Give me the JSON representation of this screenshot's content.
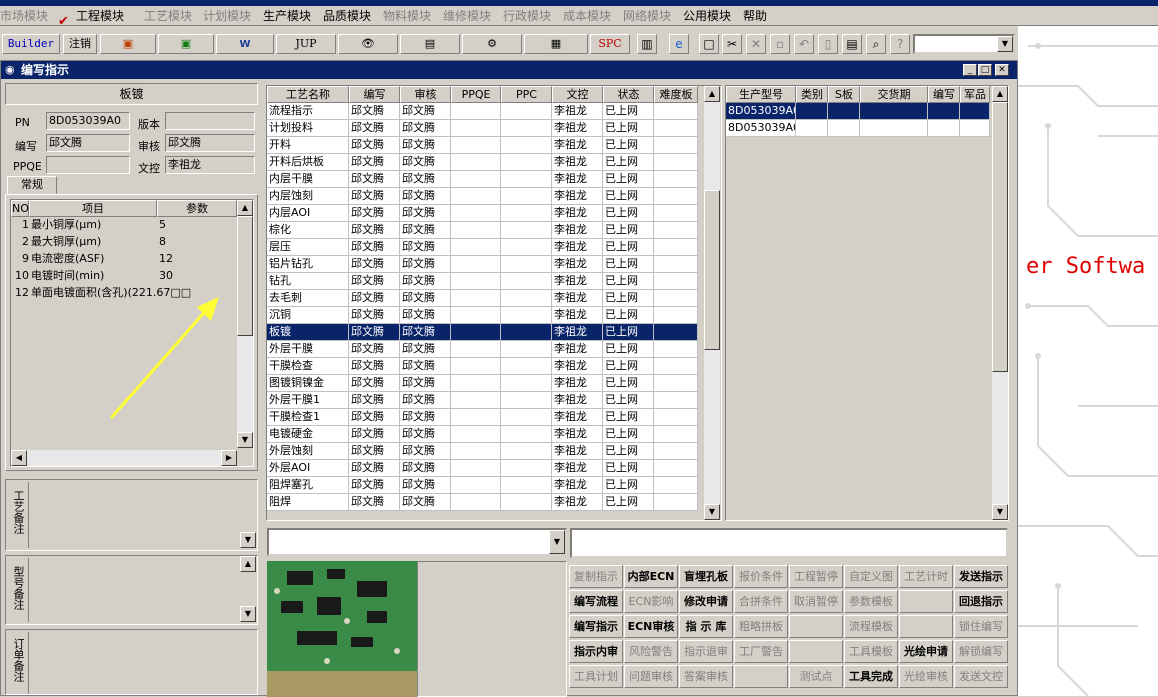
{
  "menu": [
    "市场模块",
    "工程模块",
    "工艺模块",
    "计划模块",
    "生产模块",
    "品质模块",
    "物料模块",
    "维修模块",
    "行政模块",
    "成本模块",
    "网络模块",
    "公用模块",
    "帮助"
  ],
  "menu_enabled": [
    false,
    true,
    false,
    false,
    true,
    true,
    false,
    false,
    false,
    false,
    false,
    true,
    true
  ],
  "toolbar": {
    "builder": "Builder",
    "logout": "注销",
    "jup": "JUP",
    "spc": "SPC"
  },
  "window": {
    "title": "编写指示"
  },
  "left": {
    "section_title": "板镀",
    "pn_label": "PN",
    "pn": "8D053039A0",
    "version_label": "版本",
    "version": "",
    "writer_label": "编写",
    "writer": "邱文腾",
    "reviewer_label": "审核",
    "reviewer": "邱文腾",
    "ppqe_label": "PPQE",
    "ppqe": "",
    "doc_label": "文控",
    "doc": "李祖龙",
    "tab": "常规",
    "param_headers": [
      "NO",
      "项目",
      "参数"
    ],
    "params": [
      {
        "no": "1",
        "item": "最小铜厚(μm)",
        "val": "5"
      },
      {
        "no": "2",
        "item": "最大铜厚(μm)",
        "val": "8"
      },
      {
        "no": "9",
        "item": "电流密度(ASF)",
        "val": "12"
      },
      {
        "no": "10",
        "item": "电镀时间(min)",
        "val": "30"
      },
      {
        "no": "12",
        "item": "单面电镀面积(含孔)(221.67□□",
        "val": ""
      }
    ],
    "memo_labels": [
      "工艺备注",
      "型号备注",
      "订单备注"
    ]
  },
  "process": {
    "headers": [
      "工艺名称",
      "编写",
      "审核",
      "PPQE",
      "PPC",
      "文控",
      "状态",
      "难度板"
    ],
    "rows": [
      [
        "流程指示",
        "邱文腾",
        "邱文腾",
        "",
        "",
        "李祖龙",
        "已上网",
        ""
      ],
      [
        "计划投料",
        "邱文腾",
        "邱文腾",
        "",
        "",
        "李祖龙",
        "已上网",
        ""
      ],
      [
        "开料",
        "邱文腾",
        "邱文腾",
        "",
        "",
        "李祖龙",
        "已上网",
        ""
      ],
      [
        "开料后烘板",
        "邱文腾",
        "邱文腾",
        "",
        "",
        "李祖龙",
        "已上网",
        ""
      ],
      [
        "内层干膜",
        "邱文腾",
        "邱文腾",
        "",
        "",
        "李祖龙",
        "已上网",
        ""
      ],
      [
        "内层蚀刻",
        "邱文腾",
        "邱文腾",
        "",
        "",
        "李祖龙",
        "已上网",
        ""
      ],
      [
        "内层AOI",
        "邱文腾",
        "邱文腾",
        "",
        "",
        "李祖龙",
        "已上网",
        ""
      ],
      [
        "棕化",
        "邱文腾",
        "邱文腾",
        "",
        "",
        "李祖龙",
        "已上网",
        ""
      ],
      [
        "层压",
        "邱文腾",
        "邱文腾",
        "",
        "",
        "李祖龙",
        "已上网",
        ""
      ],
      [
        "铝片钻孔",
        "邱文腾",
        "邱文腾",
        "",
        "",
        "李祖龙",
        "已上网",
        ""
      ],
      [
        "钻孔",
        "邱文腾",
        "邱文腾",
        "",
        "",
        "李祖龙",
        "已上网",
        ""
      ],
      [
        "去毛刺",
        "邱文腾",
        "邱文腾",
        "",
        "",
        "李祖龙",
        "已上网",
        ""
      ],
      [
        "沉铜",
        "邱文腾",
        "邱文腾",
        "",
        "",
        "李祖龙",
        "已上网",
        ""
      ],
      [
        "板镀",
        "邱文腾",
        "邱文腾",
        "",
        "",
        "李祖龙",
        "已上网",
        ""
      ],
      [
        "外层干膜",
        "邱文腾",
        "邱文腾",
        "",
        "",
        "李祖龙",
        "已上网",
        ""
      ],
      [
        "干膜检查",
        "邱文腾",
        "邱文腾",
        "",
        "",
        "李祖龙",
        "已上网",
        ""
      ],
      [
        "图镀铜镍金",
        "邱文腾",
        "邱文腾",
        "",
        "",
        "李祖龙",
        "已上网",
        ""
      ],
      [
        "外层干膜1",
        "邱文腾",
        "邱文腾",
        "",
        "",
        "李祖龙",
        "已上网",
        ""
      ],
      [
        "干膜检查1",
        "邱文腾",
        "邱文腾",
        "",
        "",
        "李祖龙",
        "已上网",
        ""
      ],
      [
        "电镀硬金",
        "邱文腾",
        "邱文腾",
        "",
        "",
        "李祖龙",
        "已上网",
        ""
      ],
      [
        "外层蚀刻",
        "邱文腾",
        "邱文腾",
        "",
        "",
        "李祖龙",
        "已上网",
        ""
      ],
      [
        "外层AOI",
        "邱文腾",
        "邱文腾",
        "",
        "",
        "李祖龙",
        "已上网",
        ""
      ],
      [
        "阻焊塞孔",
        "邱文腾",
        "邱文腾",
        "",
        "",
        "李祖龙",
        "已上网",
        ""
      ],
      [
        "阻焊",
        "邱文腾",
        "邱文腾",
        "",
        "",
        "李祖龙",
        "已上网",
        ""
      ]
    ],
    "selected": 13
  },
  "models": {
    "headers": [
      "生产型号",
      "类别",
      "S板",
      "交货期",
      "编写",
      "军品"
    ],
    "rows": [
      [
        "8D053039A0",
        "",
        "",
        "",
        "",
        ""
      ],
      [
        "8D053039A0",
        "",
        "",
        "",
        "",
        ""
      ]
    ],
    "selected": 0
  },
  "background_text": "er Softwa",
  "actions": [
    [
      {
        "t": "复制指示",
        "e": false
      },
      {
        "t": "内部ECN",
        "e": true
      },
      {
        "t": "盲埋孔板",
        "e": true
      },
      {
        "t": "报价条件",
        "e": false
      },
      {
        "t": "工程暂停",
        "e": false
      },
      {
        "t": "自定义图",
        "e": false
      },
      {
        "t": "工艺计时",
        "e": false
      },
      {
        "t": "发送指示",
        "e": true
      }
    ],
    [
      {
        "t": "编写流程",
        "e": true
      },
      {
        "t": "ECN影响",
        "e": false
      },
      {
        "t": "修改申请",
        "e": true
      },
      {
        "t": "合拼条件",
        "e": false
      },
      {
        "t": "取消暂停",
        "e": false
      },
      {
        "t": "参数模板",
        "e": false
      },
      {
        "t": "",
        "e": false
      },
      {
        "t": "回退指示",
        "e": true
      }
    ],
    [
      {
        "t": "编写指示",
        "e": true
      },
      {
        "t": "ECN审核",
        "e": true
      },
      {
        "t": "指 示 库",
        "e": true
      },
      {
        "t": "粗略拼板",
        "e": false
      },
      {
        "t": "",
        "e": false
      },
      {
        "t": "流程模板",
        "e": false
      },
      {
        "t": "",
        "e": false
      },
      {
        "t": "锁住编写",
        "e": false
      }
    ],
    [
      {
        "t": "指示内审",
        "e": true
      },
      {
        "t": "风险警告",
        "e": false
      },
      {
        "t": "指示退审",
        "e": false
      },
      {
        "t": "工厂警告",
        "e": false
      },
      {
        "t": "",
        "e": false
      },
      {
        "t": "工具模板",
        "e": false
      },
      {
        "t": "光绘申请",
        "e": true
      },
      {
        "t": "解锁编写",
        "e": false
      }
    ],
    [
      {
        "t": "工具计划",
        "e": false
      },
      {
        "t": "问题审核",
        "e": false
      },
      {
        "t": "答案审核",
        "e": false
      },
      {
        "t": "",
        "e": false
      },
      {
        "t": "测试点",
        "e": false
      },
      {
        "t": "工具完成",
        "e": true
      },
      {
        "t": "光绘审核",
        "e": false
      },
      {
        "t": "发送文控",
        "e": false
      }
    ]
  ],
  "colors": {
    "selection": "#0a246a",
    "arrow": "#ffff33",
    "bg_text": "#e00000",
    "pcb": "#2f7a3c"
  }
}
